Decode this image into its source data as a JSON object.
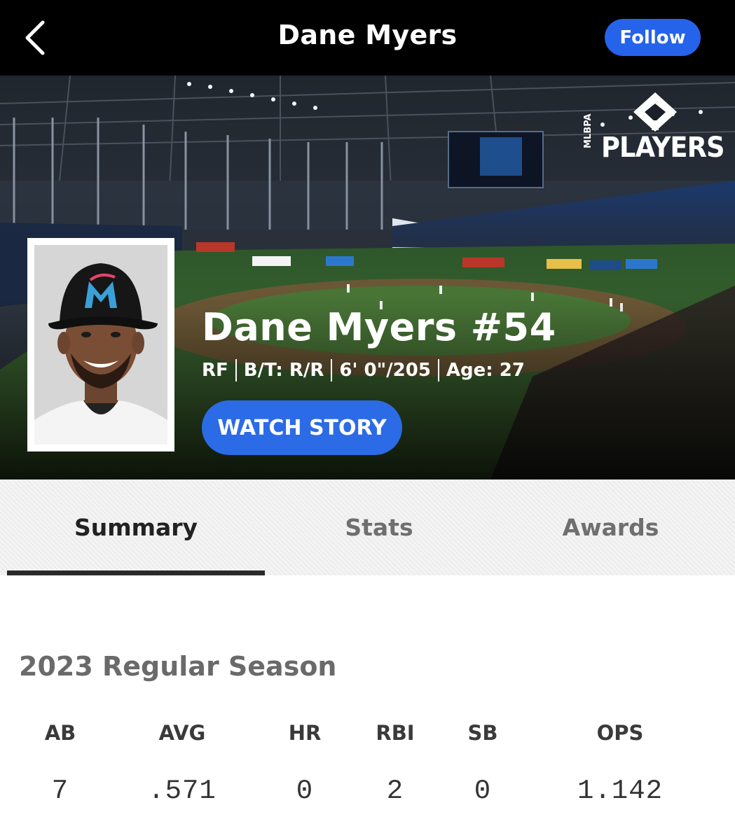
{
  "header": {
    "title": "Dane Myers",
    "follow_label": "Follow"
  },
  "hero": {
    "logo_text": "PLAYERS",
    "logo_small": "MLBPA",
    "name_number": "Dane Myers #54",
    "position": "RF",
    "bats_throws": "B/T: R/R",
    "height_weight": "6' 0\"/205",
    "age": "Age: 27",
    "watch_label": "WATCH STORY"
  },
  "tabs": [
    {
      "label": "Summary",
      "active": true
    },
    {
      "label": "Stats",
      "active": false
    },
    {
      "label": "Awards",
      "active": false
    }
  ],
  "season": {
    "title": "2023 Regular Season",
    "stats": [
      {
        "label": "AB",
        "value": "7"
      },
      {
        "label": "AVG",
        "value": ".571"
      },
      {
        "label": "HR",
        "value": "0"
      },
      {
        "label": "RBI",
        "value": "2"
      },
      {
        "label": "SB",
        "value": "0"
      },
      {
        "label": "OPS",
        "value": "1.142"
      }
    ]
  },
  "colors": {
    "accent_blue": "#2563eb",
    "header_bg": "#000000"
  }
}
